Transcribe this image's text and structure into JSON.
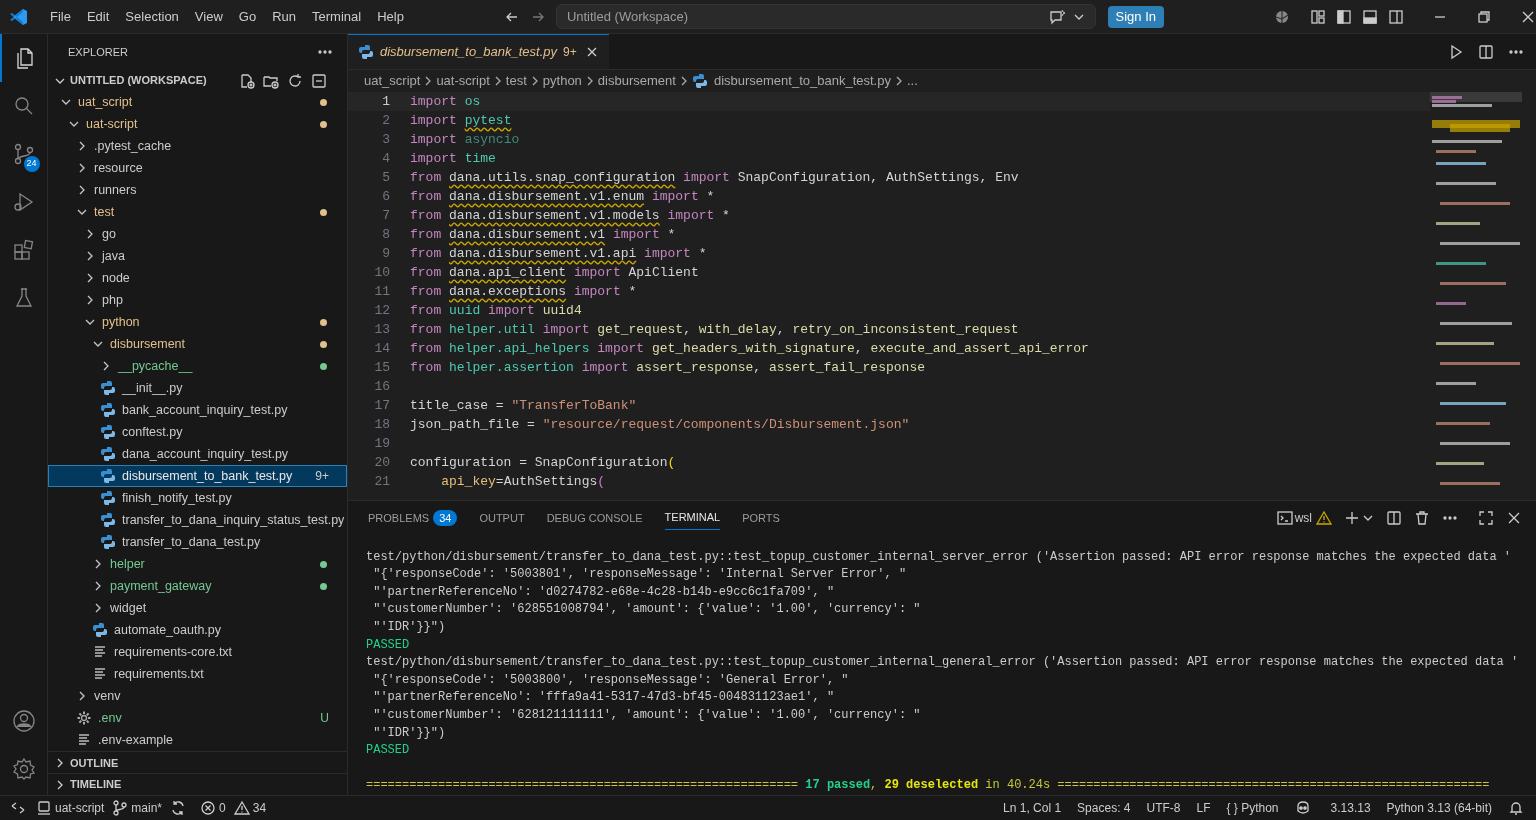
{
  "title_bar": {
    "menu": [
      "File",
      "Edit",
      "Selection",
      "View",
      "Go",
      "Run",
      "Terminal",
      "Help"
    ],
    "search": {
      "value": "Untitled (Workspace)"
    },
    "sign_in": "Sign In"
  },
  "activity_bar": {
    "items": [
      {
        "kind": "files",
        "selected": true
      },
      {
        "kind": "search",
        "selected": false
      },
      {
        "kind": "source-control",
        "selected": false,
        "badge": "24"
      },
      {
        "kind": "run",
        "selected": false
      },
      {
        "kind": "extensions",
        "selected": false
      },
      {
        "kind": "testing",
        "selected": false
      }
    ]
  },
  "sidebar": {
    "title": "EXPLORER",
    "workspace": "UNTITLED (WORKSPACE)",
    "tree": [
      {
        "label": "uat_script",
        "kind": "folder",
        "expanded": true,
        "selected": false,
        "color": "#e2c08d",
        "dot": true,
        "children": [
          {
            "label": "uat-script",
            "kind": "folder",
            "expanded": true,
            "selected": false,
            "color": "#e2c08d",
            "dot": true,
            "children": [
              {
                "label": ".pytest_cache",
                "kind": "folder",
                "expanded": false,
                "selected": false
              },
              {
                "label": "resource",
                "kind": "folder",
                "expanded": false,
                "selected": false
              },
              {
                "label": "runners",
                "kind": "folder",
                "expanded": false,
                "selected": false
              },
              {
                "label": "test",
                "kind": "folder",
                "expanded": true,
                "selected": false,
                "color": "#e2c08d",
                "dot": true,
                "children": [
                  {
                    "label": "go",
                    "kind": "folder",
                    "expanded": false,
                    "selected": false
                  },
                  {
                    "label": "java",
                    "kind": "folder",
                    "expanded": false,
                    "selected": false
                  },
                  {
                    "label": "node",
                    "kind": "folder",
                    "expanded": false,
                    "selected": false
                  },
                  {
                    "label": "php",
                    "kind": "folder",
                    "expanded": false,
                    "selected": false
                  },
                  {
                    "label": "python",
                    "kind": "folder",
                    "expanded": true,
                    "selected": false,
                    "color": "#e2c08d",
                    "dot": true,
                    "children": [
                      {
                        "label": "disbursement",
                        "kind": "folder",
                        "expanded": true,
                        "selected": false,
                        "color": "#e2c08d",
                        "dot": true,
                        "children": [
                          {
                            "label": "__pycache__",
                            "kind": "folder",
                            "expanded": false,
                            "selected": false,
                            "color": "#73c991",
                            "dot": true
                          },
                          {
                            "label": "__init__.py",
                            "kind": "py",
                            "selected": false
                          },
                          {
                            "label": "bank_account_inquiry_test.py",
                            "kind": "py",
                            "selected": false
                          },
                          {
                            "label": "conftest.py",
                            "kind": "py",
                            "selected": false
                          },
                          {
                            "label": "dana_account_inquiry_test.py",
                            "kind": "py",
                            "selected": false
                          },
                          {
                            "label": "disbursement_to_bank_test.py",
                            "kind": "py",
                            "selected": true,
                            "badge": "9+"
                          },
                          {
                            "label": "finish_notify_test.py",
                            "kind": "py",
                            "selected": false
                          },
                          {
                            "label": "transfer_to_dana_inquiry_status_test.py",
                            "kind": "py",
                            "selected": false
                          },
                          {
                            "label": "transfer_to_dana_test.py",
                            "kind": "py",
                            "selected": false
                          }
                        ]
                      },
                      {
                        "label": "helper",
                        "kind": "folder",
                        "expanded": false,
                        "selected": false,
                        "color": "#73c991",
                        "dot": true
                      },
                      {
                        "label": "payment_gateway",
                        "kind": "folder",
                        "expanded": false,
                        "selected": false,
                        "color": "#73c991",
                        "dot": true
                      },
                      {
                        "label": "widget",
                        "kind": "folder",
                        "expanded": false,
                        "selected": false
                      },
                      {
                        "label": "automate_oauth.py",
                        "kind": "py",
                        "selected": false
                      },
                      {
                        "label": "requirements-core.txt",
                        "kind": "txt",
                        "selected": false
                      },
                      {
                        "label": "requirements.txt",
                        "kind": "txt",
                        "selected": false
                      }
                    ]
                  }
                ]
              },
              {
                "label": "venv",
                "kind": "folder",
                "expanded": false,
                "selected": false
              },
              {
                "label": ".env",
                "kind": "gear",
                "selected": false,
                "color": "#73c991",
                "badge": "U"
              },
              {
                "label": ".env-example",
                "kind": "txt",
                "selected": false
              }
            ]
          }
        ]
      }
    ],
    "sections": [
      {
        "label": "OUTLINE",
        "expanded": false
      },
      {
        "label": "TIMELINE",
        "expanded": false
      }
    ]
  },
  "editor": {
    "tab": {
      "label": "disbursement_to_bank_test.py",
      "badge": "9+",
      "selected": true
    },
    "breadcrumbs": [
      "uat_script",
      "uat-script",
      "test",
      "python",
      "disbursement",
      "disbursement_to_bank_test.py",
      "..."
    ],
    "lines": [
      {
        "n": "1",
        "current": true,
        "tokens": [
          {
            "kind": "keyword",
            "text": "import"
          },
          {
            "kind": "module",
            "text": " os"
          }
        ]
      },
      {
        "n": "2",
        "current": false,
        "tokens": [
          {
            "kind": "keyword",
            "text": "import"
          },
          {
            "kind": "module",
            "text": " pytest",
            "squiggle": true
          }
        ]
      },
      {
        "n": "3",
        "current": false,
        "tokens": [
          {
            "kind": "keyword",
            "text": "import"
          },
          {
            "kind": "unused",
            "text": " asyncio"
          }
        ]
      },
      {
        "n": "4",
        "current": false,
        "tokens": [
          {
            "kind": "keyword",
            "text": "import"
          },
          {
            "kind": "module",
            "text": " time"
          }
        ]
      },
      {
        "n": "5",
        "current": false,
        "tokens": [
          {
            "kind": "keyword",
            "text": "from"
          },
          {
            "kind": "plain",
            "text": " dana.utils.snap_configuration",
            "squiggle": true
          },
          {
            "kind": "keyword",
            "text": " import"
          },
          {
            "kind": "plain",
            "text": " SnapConfiguration, AuthSettings, Env"
          }
        ]
      },
      {
        "n": "6",
        "current": false,
        "tokens": [
          {
            "kind": "keyword",
            "text": "from"
          },
          {
            "kind": "plain",
            "text": " dana.disbursement.v1.enum",
            "squiggle": true
          },
          {
            "kind": "keyword",
            "text": " import"
          },
          {
            "kind": "plain",
            "text": " *"
          }
        ]
      },
      {
        "n": "7",
        "current": false,
        "tokens": [
          {
            "kind": "keyword",
            "text": "from"
          },
          {
            "kind": "plain",
            "text": " dana.disbursement.v1.models",
            "squiggle": true
          },
          {
            "kind": "keyword",
            "text": " import"
          },
          {
            "kind": "plain",
            "text": " *"
          }
        ]
      },
      {
        "n": "8",
        "current": false,
        "tokens": [
          {
            "kind": "keyword",
            "text": "from"
          },
          {
            "kind": "plain",
            "text": " dana.disbursement.v1",
            "squiggle": true
          },
          {
            "kind": "keyword",
            "text": " import"
          },
          {
            "kind": "plain",
            "text": " *"
          }
        ]
      },
      {
        "n": "9",
        "current": false,
        "tokens": [
          {
            "kind": "keyword",
            "text": "from"
          },
          {
            "kind": "plain",
            "text": " dana.disbursement.v1.api",
            "squiggle": true
          },
          {
            "kind": "keyword",
            "text": " import"
          },
          {
            "kind": "plain",
            "text": " *"
          }
        ]
      },
      {
        "n": "10",
        "current": false,
        "tokens": [
          {
            "kind": "keyword",
            "text": "from"
          },
          {
            "kind": "plain",
            "text": " dana.api_client",
            "squiggle": true
          },
          {
            "kind": "keyword",
            "text": " import"
          },
          {
            "kind": "plain",
            "text": " ApiClient"
          }
        ]
      },
      {
        "n": "11",
        "current": false,
        "tokens": [
          {
            "kind": "keyword",
            "text": "from"
          },
          {
            "kind": "plain",
            "text": " dana.exceptions",
            "squiggle": true
          },
          {
            "kind": "keyword",
            "text": " import"
          },
          {
            "kind": "plain",
            "text": " *"
          }
        ]
      },
      {
        "n": "12",
        "current": false,
        "tokens": [
          {
            "kind": "keyword",
            "text": "from"
          },
          {
            "kind": "module",
            "text": " uuid"
          },
          {
            "kind": "keyword",
            "text": " import"
          },
          {
            "kind": "function",
            "text": " uuid4"
          }
        ]
      },
      {
        "n": "13",
        "current": false,
        "tokens": [
          {
            "kind": "keyword",
            "text": "from"
          },
          {
            "kind": "module",
            "text": " helper.util"
          },
          {
            "kind": "keyword",
            "text": " import"
          },
          {
            "kind": "function",
            "text": " get_request"
          },
          {
            "kind": "plain",
            "text": ","
          },
          {
            "kind": "function",
            "text": " with_delay"
          },
          {
            "kind": "plain",
            "text": ","
          },
          {
            "kind": "function",
            "text": " retry_on_inconsistent_request"
          }
        ]
      },
      {
        "n": "14",
        "current": false,
        "tokens": [
          {
            "kind": "keyword",
            "text": "from"
          },
          {
            "kind": "module",
            "text": " helper.api_helpers"
          },
          {
            "kind": "keyword",
            "text": " import"
          },
          {
            "kind": "function",
            "text": " get_headers_with_signature"
          },
          {
            "kind": "plain",
            "text": ","
          },
          {
            "kind": "function",
            "text": " execute_and_assert_api_error"
          }
        ]
      },
      {
        "n": "15",
        "current": false,
        "tokens": [
          {
            "kind": "keyword",
            "text": "from"
          },
          {
            "kind": "module",
            "text": " helper.assertion"
          },
          {
            "kind": "keyword",
            "text": " import"
          },
          {
            "kind": "function",
            "text": " assert_response"
          },
          {
            "kind": "plain",
            "text": ","
          },
          {
            "kind": "function",
            "text": " assert_fail_response"
          }
        ]
      },
      {
        "n": "16",
        "current": false
      },
      {
        "n": "17",
        "current": false,
        "tokens": [
          {
            "kind": "plain",
            "text": "title_case ="
          },
          {
            "kind": "string",
            "text": " \"TransferToBank\""
          }
        ]
      },
      {
        "n": "18",
        "current": false,
        "tokens": [
          {
            "kind": "plain",
            "text": "json_path_file ="
          },
          {
            "kind": "string",
            "text": " \"resource/request/components/Disbursement.json\""
          }
        ]
      },
      {
        "n": "19",
        "current": false
      },
      {
        "n": "20",
        "current": false,
        "tokens": [
          {
            "kind": "plain",
            "text": "configuration = SnapConfiguration"
          },
          {
            "kind": "bracket",
            "text": "("
          }
        ]
      },
      {
        "n": "21",
        "current": false,
        "tokens": [
          {
            "kind": "param",
            "text": "    api_key"
          },
          {
            "kind": "plain",
            "text": "=AuthSettings"
          },
          {
            "kind": "bracket2",
            "text": "("
          }
        ]
      }
    ]
  },
  "panel": {
    "tabs": [
      {
        "label": "PROBLEMS",
        "badge": "34",
        "selected": false
      },
      {
        "label": "OUTPUT",
        "selected": false
      },
      {
        "label": "DEBUG CONSOLE",
        "selected": false
      },
      {
        "label": "TERMINAL",
        "selected": true
      },
      {
        "label": "PORTS",
        "selected": false
      }
    ],
    "terminal_name": "wsl",
    "lines": [
      {
        "kind": "text",
        "text": "test/python/disbursement/transfer_to_dana_test.py::test_topup_customer_internal_server_error ('Assertion passed: API error response matches the expected data '"
      },
      {
        "kind": "text",
        "text": " \"{'responseCode': '5003801', 'responseMessage': 'Internal Server Error', \""
      },
      {
        "kind": "text",
        "text": " \"'partnerReferenceNo': 'd0274782-e68e-4c28-b14b-e9cc6c1fa709', \""
      },
      {
        "kind": "text",
        "text": " \"'customerNumber': '628551008794', 'amount': {'value': '1.00', 'currency': \""
      },
      {
        "kind": "text",
        "text": " \"'IDR'}}\")"
      },
      {
        "kind": "passed",
        "text": "PASSED"
      },
      {
        "kind": "text",
        "text": "test/python/disbursement/transfer_to_dana_test.py::test_topup_customer_internal_general_error ('Assertion passed: API error response matches the expected data '"
      },
      {
        "kind": "text",
        "text": " \"{'responseCode': '5003800', 'responseMessage': 'General Error', \""
      },
      {
        "kind": "text",
        "text": " \"'partnerReferenceNo': 'fffa9a41-5317-47d3-bf45-004831123ae1', \""
      },
      {
        "kind": "text",
        "text": " \"'customerNumber': '628121111111', 'amount': {'value': '1.00', 'currency': \""
      },
      {
        "kind": "text",
        "text": " \"'IDR'}}\")"
      },
      {
        "kind": "passed",
        "text": "PASSED"
      },
      {
        "kind": "blank"
      },
      {
        "kind": "summary",
        "parts": [
          {
            "kind": "rule",
            "text": "============================================================ "
          },
          {
            "kind": "pass",
            "text": "17 passed"
          },
          {
            "kind": "rule",
            "text": ", "
          },
          {
            "kind": "warn",
            "text": "29 deselected"
          },
          {
            "kind": "rule",
            "text": " in 40.24s "
          },
          {
            "kind": "rule",
            "text": "============================================================"
          }
        ]
      }
    ]
  },
  "status_bar": {
    "left": [
      {
        "kind": "laptop",
        "text": "uat-script"
      },
      {
        "kind": "branch",
        "text": "main*"
      },
      {
        "kind": "sync"
      },
      {
        "kind": "error",
        "text": "0"
      },
      {
        "kind": "warning",
        "text": "34"
      }
    ],
    "right": [
      {
        "kind": "text",
        "text": "Ln 1, Col 1"
      },
      {
        "kind": "text",
        "text": "Spaces: 4"
      },
      {
        "kind": "text",
        "text": "UTF-8"
      },
      {
        "kind": "text",
        "text": "LF"
      },
      {
        "kind": "text",
        "text": "{ } Python"
      },
      {
        "kind": "copilot"
      },
      {
        "kind": "text",
        "text": "3.13.13"
      },
      {
        "kind": "text",
        "text": "Python 3.13 (64-bit)"
      },
      {
        "kind": "bell"
      }
    ]
  }
}
